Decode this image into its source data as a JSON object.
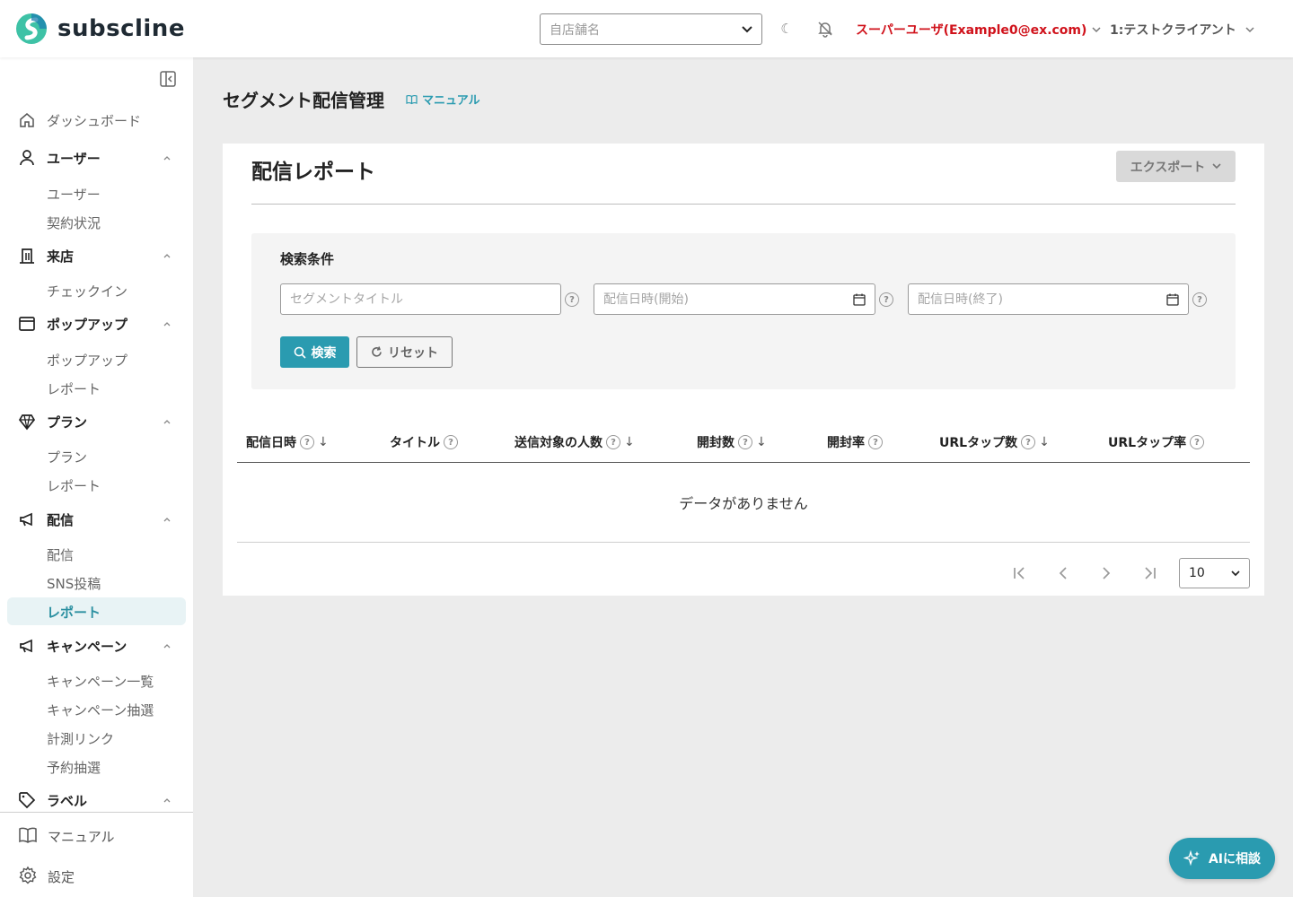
{
  "header": {
    "brand": "subscline",
    "store_select_placeholder": "自店舗名",
    "user_name": "スーパーユーザ(Example0@ex.com)",
    "client_name": "1:テストクライアント",
    "icons": [
      "moon-icon",
      "bell-off-icon"
    ]
  },
  "sidebar": {
    "sections": [
      {
        "label": "ダッシュボード",
        "icon": "home-icon"
      },
      {
        "label": "ユーザー",
        "icon": "user-icon",
        "items": [
          "ユーザー",
          "契約状況"
        ]
      },
      {
        "label": "来店",
        "icon": "building-icon",
        "items": [
          "チェックイン"
        ]
      },
      {
        "label": "ポップアップ",
        "icon": "window-icon",
        "items": [
          "ポップアップ",
          "レポート"
        ]
      },
      {
        "label": "プラン",
        "icon": "gem-icon",
        "items": [
          "プラン",
          "レポート"
        ]
      },
      {
        "label": "配信",
        "icon": "megaphone-icon",
        "items": [
          "配信",
          "SNS投稿",
          "レポート"
        ],
        "active_item": "レポート"
      },
      {
        "label": "キャンペーン",
        "icon": "megaphone-icon",
        "items": [
          "キャンペーン一覧",
          "キャンペーン抽選",
          "計測リンク",
          "予約抽選"
        ]
      },
      {
        "label": "ラベル",
        "icon": "tag-icon"
      }
    ],
    "bottom": [
      {
        "label": "マニュアル",
        "icon": "book-icon"
      },
      {
        "label": "設定",
        "icon": "gear-icon"
      }
    ]
  },
  "page": {
    "title": "セグメント配信管理",
    "manual_link": "マニュアル"
  },
  "card": {
    "title": "配信レポート",
    "export_label": "エクスポート",
    "search": {
      "heading": "検索条件",
      "title_placeholder": "セグメントタイトル",
      "start_placeholder": "配信日時(開始)",
      "end_placeholder": "配信日時(終了)",
      "search_label": "検索",
      "reset_label": "リセット"
    },
    "table": {
      "columns": [
        "配信日時",
        "タイトル",
        "送信対象の人数",
        "開封数",
        "開封率",
        "URLタップ数",
        "URLタップ率"
      ],
      "empty_message": "データがありません",
      "page_size": "10"
    }
  },
  "ai_button_label": "AIに相談",
  "colors": {
    "accent": "#2a9bb0",
    "user_red": "#d0121b",
    "background": "#ececec"
  }
}
